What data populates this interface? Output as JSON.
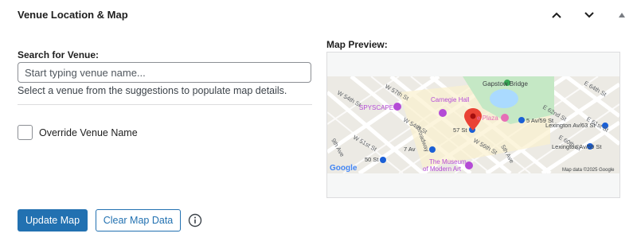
{
  "panel": {
    "title": "Venue Location & Map",
    "controls": [
      "move-up-icon",
      "move-down-icon",
      "toggle-panel-icon"
    ]
  },
  "search": {
    "label": "Search for Venue:",
    "placeholder": "Start typing venue name...",
    "value": "",
    "help": "Select a venue from the suggestions to populate map details."
  },
  "override": {
    "label": "Override Venue Name",
    "checked": false
  },
  "map": {
    "label": "Map Preview:",
    "places": {
      "gapstow": "Gapstow Bridge",
      "spyscape": "SPYSCAPE",
      "carnegie": "Carnegie Hall",
      "plaza": "e Plaza",
      "moma_1": "The Museum",
      "moma_2": "of Modern Art"
    },
    "streets": {
      "w57": "W 57th St",
      "w54a": "W 54th St",
      "w54b": "W 54th St",
      "broadway": "Broadway",
      "w51": "W 51st St",
      "ninth": "9th Ave",
      "w56": "W 56th St",
      "fifth": "5th Ave",
      "e62": "E 62nd St",
      "e60": "E 60th St",
      "e61": "E 61st St",
      "e64": "E 64th St"
    },
    "stations": {
      "s57": "57 St",
      "sfifth": "5 Av/59 St",
      "lex": "Lexington Av/63 St",
      "seven": "7 Av",
      "s50": "50 St",
      "lex59": "Lexington Av/59 St"
    },
    "logo": "Google",
    "attribution": "Map data ©2025 Google",
    "colors": {
      "land": "#f5f0e4",
      "park": "#c5e8c5",
      "water": "#aadaff",
      "street": "#ffffff",
      "pin": "#ea4335",
      "transit": "#1a5fd6",
      "poi": "#b44bd6"
    }
  },
  "actions": {
    "update": "Update Map",
    "clear": "Clear Map Data",
    "info_icon": "info-icon"
  },
  "colors": {
    "primary": "#2271b1",
    "border": "#8c8f94"
  }
}
